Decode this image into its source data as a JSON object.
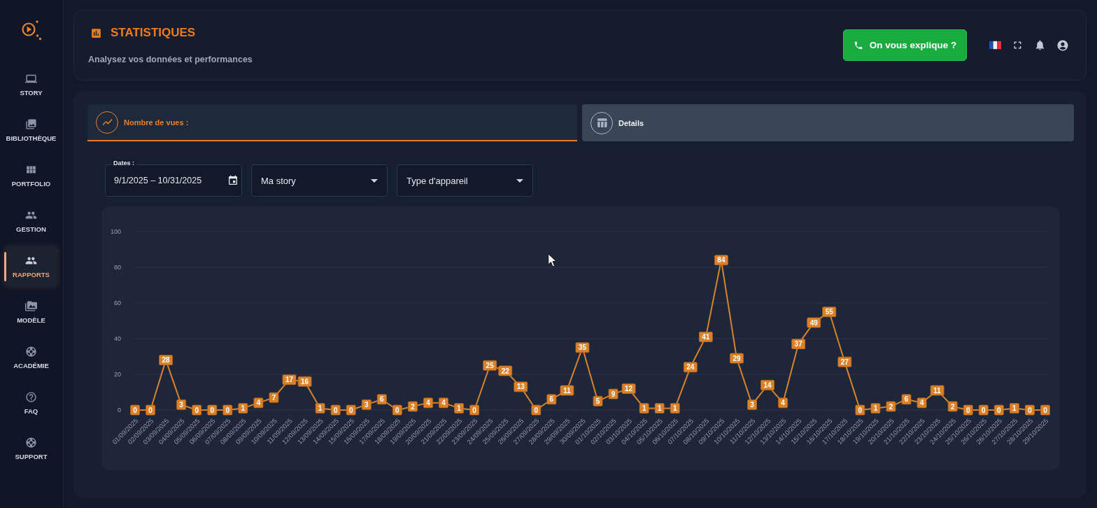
{
  "sidebar": {
    "items": [
      {
        "label": "STORY",
        "selected": false
      },
      {
        "label": "BIBLIOTHÈQUE",
        "selected": false
      },
      {
        "label": "PORTFOLIO",
        "selected": false
      },
      {
        "label": "GESTION",
        "selected": false
      },
      {
        "label": "RAPPORTS",
        "selected": true
      },
      {
        "label": "MODÈLE",
        "selected": false
      },
      {
        "label": "ACADÉMIE",
        "selected": false
      },
      {
        "label": "FAQ",
        "selected": false
      },
      {
        "label": "SUPPORT",
        "selected": false
      }
    ]
  },
  "header": {
    "title": "STATISTIQUES",
    "subtitle": "Analysez vos données et performances",
    "help_button": "On vous explique ?"
  },
  "tabs": [
    {
      "label": "Nombre de vues :",
      "selected": true
    },
    {
      "label": "Details",
      "selected": false
    }
  ],
  "filters": {
    "date_range": {
      "label": "Dates :",
      "value": "9/1/2025 – 10/31/2025"
    },
    "story_select": {
      "value": "Ma story"
    },
    "device_select": {
      "value": "Type d'appareil"
    }
  },
  "chart": {
    "chart_data": {
      "type": "line",
      "categories": [
        "01/09/2025",
        "02/09/2025",
        "03/09/2025",
        "04/09/2025",
        "05/09/2025",
        "06/09/2025",
        "07/09/2025",
        "08/09/2025",
        "09/09/2025",
        "10/09/2025",
        "11/09/2025",
        "12/09/2025",
        "13/09/2025",
        "14/09/2025",
        "15/09/2025",
        "16/09/2025",
        "17/09/2025",
        "18/09/2025",
        "19/09/2025",
        "20/09/2025",
        "21/09/2025",
        "22/09/2025",
        "23/09/2025",
        "24/09/2025",
        "25/09/2025",
        "26/09/2025",
        "27/09/2025",
        "28/09/2025",
        "29/09/2025",
        "30/09/2025",
        "01/10/2025",
        "02/10/2025",
        "03/10/2025",
        "04/10/2025",
        "05/10/2025",
        "06/10/2025",
        "07/10/2025",
        "08/10/2025",
        "09/10/2025",
        "10/10/2025",
        "11/10/2025",
        "12/10/2025",
        "13/10/2025",
        "14/10/2025",
        "15/10/2025",
        "16/10/2025",
        "17/10/2025",
        "18/10/2025",
        "19/10/2025",
        "20/10/2025",
        "21/10/2025",
        "22/10/2025",
        "23/10/2025",
        "24/10/2025",
        "25/10/2025",
        "26/10/2025",
        "26/10/2025",
        "27/10/2025",
        "28/10/2025",
        "29/10/2025"
      ],
      "series": [
        {
          "color": "#d9822b",
          "marker": "square",
          "values": [
            0,
            0,
            28,
            3,
            0,
            0,
            0,
            1,
            4,
            7,
            17,
            16,
            1,
            0,
            0,
            3,
            6,
            0,
            2,
            4,
            4,
            1,
            0,
            25,
            22,
            13,
            0,
            6,
            11,
            35,
            5,
            9,
            12,
            1,
            1,
            1,
            24,
            41,
            84,
            29,
            3,
            14,
            4,
            37,
            49,
            55,
            27,
            0,
            1,
            2,
            6,
            4,
            11,
            2,
            0,
            0,
            0,
            1,
            0,
            0
          ]
        }
      ],
      "ylim": [
        0,
        100
      ],
      "yticks": [
        0,
        20,
        40,
        60,
        80,
        100
      ],
      "grid": true,
      "data_labels": true
    }
  }
}
